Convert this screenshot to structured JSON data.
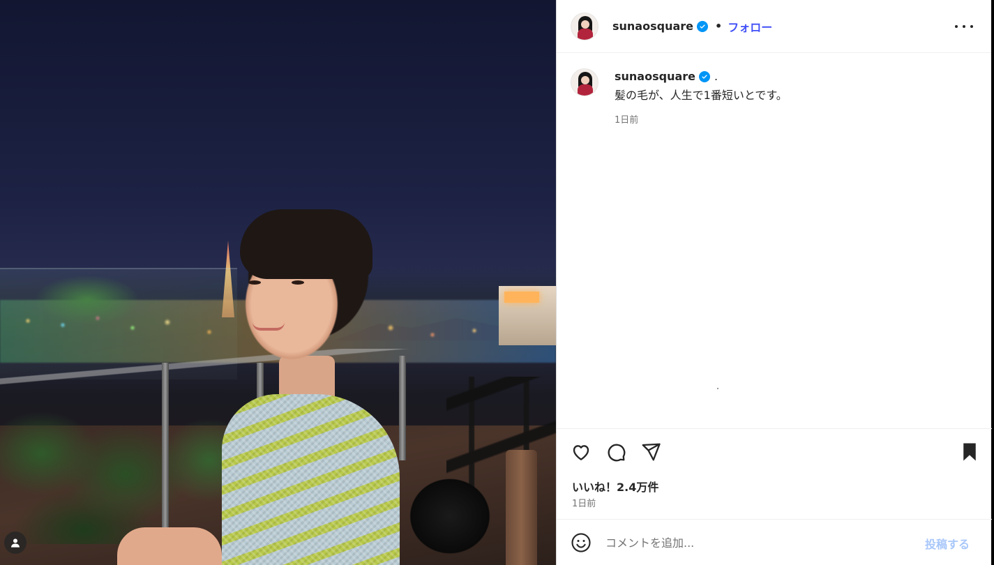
{
  "post": {
    "username": "sunaosquare",
    "separator": "•",
    "follow_label": "フォロー",
    "more_icon": "more-horizontal-icon"
  },
  "caption": {
    "username": "sunaosquare",
    "period": ".",
    "text": "髪の毛が、人生で1番短いとです。",
    "time": "1日前"
  },
  "actions": {
    "like_icon": "heart-icon",
    "comment_icon": "comment-icon",
    "share_icon": "share-icon",
    "save_icon": "bookmark-icon",
    "likes": "いいね！2.4万件",
    "time": "1日前"
  },
  "comment_box": {
    "placeholder": "コメントを追加...",
    "post_label": "投稿する",
    "emoji_icon": "emoji-icon"
  },
  "photo": {
    "tag_icon": "user-tag-icon"
  },
  "colors": {
    "accent": "#0095f6",
    "follow": "#4150f7",
    "post_disabled": "#a8c7fa",
    "text": "#262626",
    "muted": "#737373"
  }
}
